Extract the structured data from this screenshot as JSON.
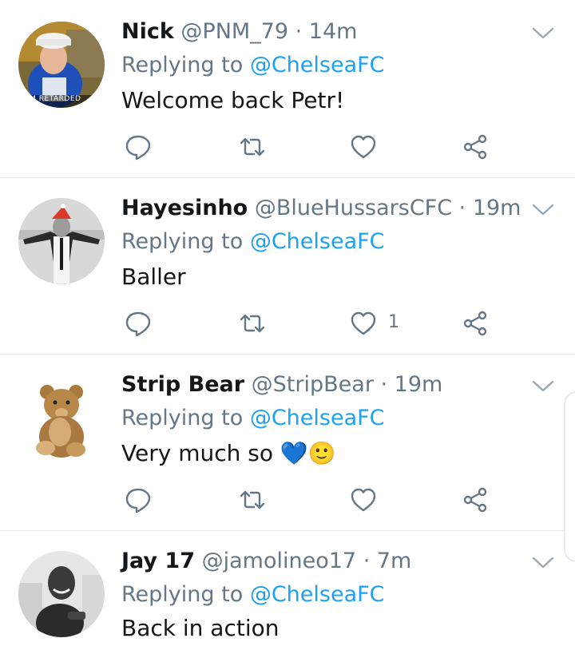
{
  "tweets": [
    {
      "name": "Nick",
      "handle": "@PNM_79",
      "time": "· 14m",
      "replying_prefix": "Replying to ",
      "replying_to": "@ChelseaFC",
      "text": "Welcome back Petr!",
      "like_count": "",
      "avatar_caption": "I'M RETARDED"
    },
    {
      "name": "Hayesinho",
      "handle": "@BlueHussarsCFC",
      "time": "· 19m",
      "replying_prefix": "Replying to ",
      "replying_to": "@ChelseaFC",
      "text": "Baller",
      "like_count": "1"
    },
    {
      "name": "Strip Bear",
      "handle": "@StripBear",
      "time": "· 19m",
      "replying_prefix": "Replying to ",
      "replying_to": "@ChelseaFC",
      "text": "Very much so",
      "text_emoji_heart": "💙",
      "text_emoji_smile": "🙂",
      "like_count": ""
    },
    {
      "name": "Jay 17",
      "handle": "@jamolineo17",
      "time": "· 7m",
      "replying_prefix": "Replying to ",
      "replying_to": "@ChelseaFC",
      "text": "Back in action",
      "like_count": ""
    }
  ],
  "colors": {
    "accent": "#1da1f2",
    "muted": "#657786",
    "divider": "#e1e8ed",
    "text": "#14171a"
  },
  "icons": [
    "chevron-down-icon",
    "reply-icon",
    "retweet-icon",
    "like-icon",
    "share-icon"
  ]
}
